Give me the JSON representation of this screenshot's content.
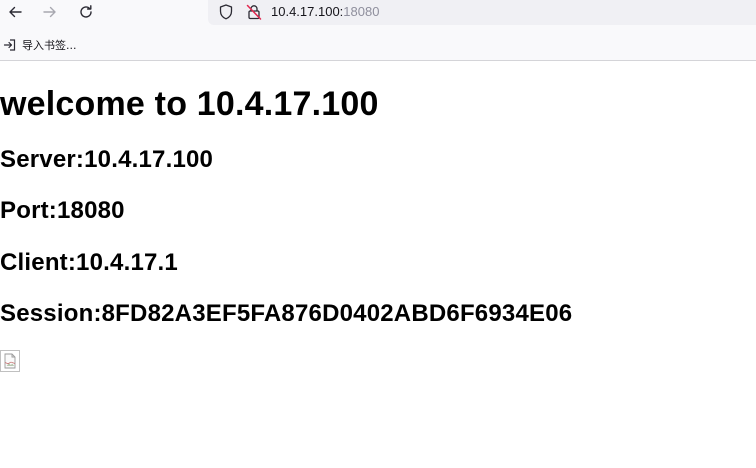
{
  "browser": {
    "url_host": "10.4.17.100:",
    "url_port": "18080",
    "icons": {
      "back": "arrow-left-icon",
      "forward": "arrow-right-icon",
      "reload": "reload-icon",
      "shield": "tracking-protection-shield-icon",
      "lock": "insecure-connection-lock-icon",
      "import": "import-bookmarks-icon"
    }
  },
  "bookmarks_bar": {
    "import_label": "导入书签..."
  },
  "page": {
    "title": "welcome to 10.4.17.100",
    "server": "Server:10.4.17.100",
    "port": "Port:18080",
    "client": "Client:10.4.17.1",
    "session": "Session:8FD82A3EF5FA876D0402ABD6F6934E06",
    "broken_image_icon": "broken-image-icon"
  }
}
